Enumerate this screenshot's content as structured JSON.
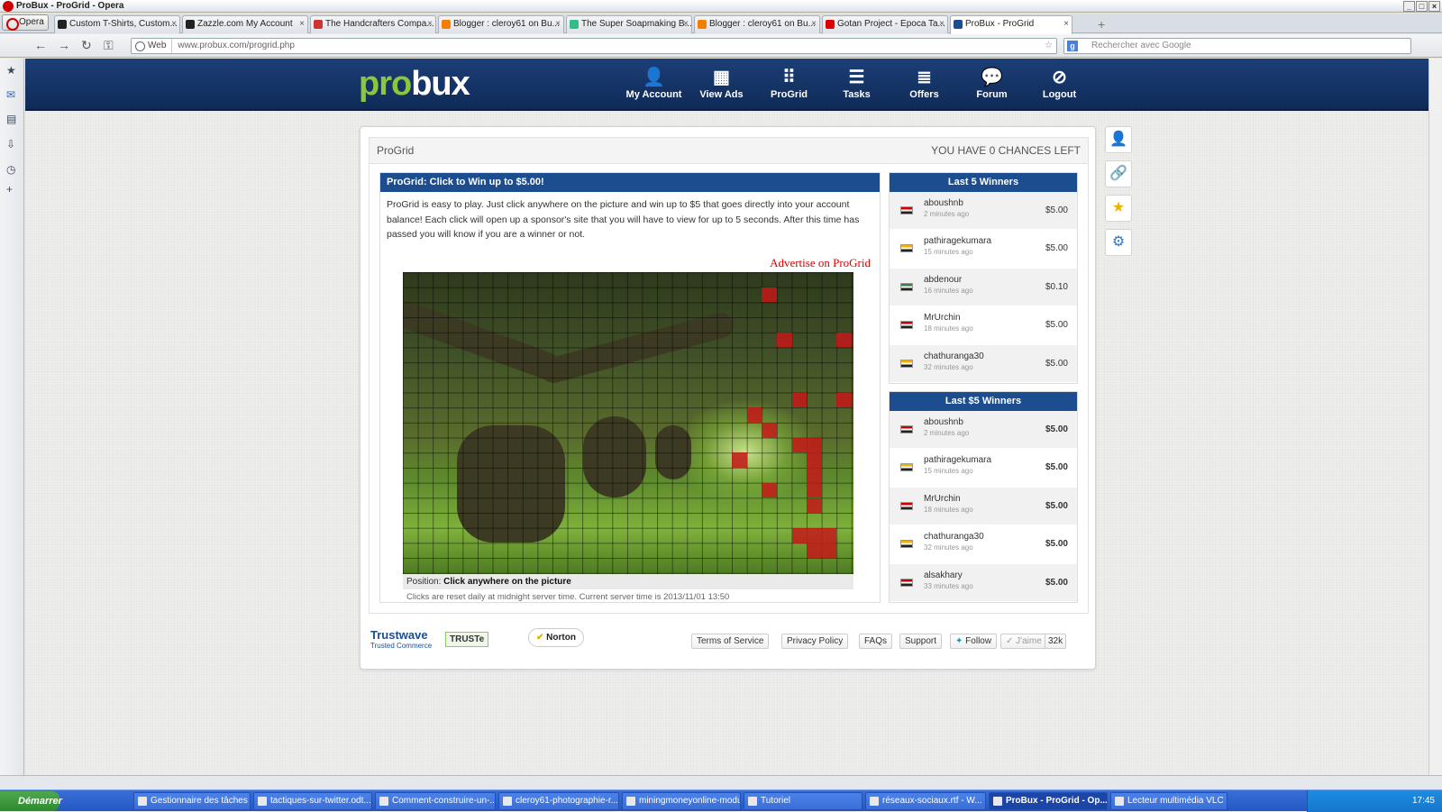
{
  "window": {
    "title": "ProBux - ProGrid - Opera"
  },
  "browser": {
    "menu_label": "Opera",
    "tabs": [
      {
        "label": "Custom T-Shirts, Custom...",
        "color": "#222"
      },
      {
        "label": "Zazzle.com My Account",
        "color": "#222"
      },
      {
        "label": "The Handcrafters Compa...",
        "color": "#c33"
      },
      {
        "label": "Blogger : cleroy61 on Bu...",
        "color": "#f57d00"
      },
      {
        "label": "The Super Soapmaking B...",
        "color": "#3b8"
      },
      {
        "label": "Blogger : cleroy61 on Bu...",
        "color": "#f57d00"
      },
      {
        "label": "Gotan Project - Epoca Ta...",
        "color": "#d00"
      },
      {
        "label": "ProBux - ProGrid",
        "color": "#1b4d8f"
      }
    ],
    "web_label": "Web",
    "url": "www.probux.com/progrid.php",
    "search_placeholder": "Rechercher avec Google"
  },
  "site": {
    "logo_part1": "pro",
    "logo_part2": "bux",
    "nav": [
      {
        "label": "My Account",
        "icon": "user-icon"
      },
      {
        "label": "View Ads",
        "icon": "ads-icon"
      },
      {
        "label": "ProGrid",
        "icon": "grid-icon"
      },
      {
        "label": "Tasks",
        "icon": "tasks-icon"
      },
      {
        "label": "Offers",
        "icon": "offers-icon"
      },
      {
        "label": "Forum",
        "icon": "forum-icon"
      },
      {
        "label": "Logout",
        "icon": "logout-icon"
      }
    ]
  },
  "progrid": {
    "header_title": "ProGrid",
    "chances": "YOU HAVE 0 CHANCES LEFT",
    "panel_title": "ProGrid: Click to Win up to $5.00!",
    "intro": "ProGrid is easy to play. Just click anywhere on the picture and win up to $5 that goes directly into your account balance! Each click will open up a sponsor's site that you will have to view for up to 5 seconds. After this time has passed you will know if you are a winner or not.",
    "advertise": "Advertise on ProGrid",
    "position_label": "Position:",
    "position_value": "Click anywhere on the picture",
    "reset_note": "Clicks are reset daily at midnight server time. Current server time is 2013/11/01 13:50"
  },
  "last5": {
    "title": "Last 5 Winners",
    "rows": [
      {
        "name": "aboushnb",
        "time": "2 minutes ago",
        "amount": "$5.00",
        "flag": "#c00"
      },
      {
        "name": "pathiragekumara",
        "time": "15 minutes ago",
        "amount": "$5.00",
        "flag": "#f5b000"
      },
      {
        "name": "abdenour",
        "time": "16 minutes ago",
        "amount": "$0.10",
        "flag": "#2a8a3a"
      },
      {
        "name": "MrUrchin",
        "time": "18 minutes ago",
        "amount": "$5.00",
        "flag": "#c00"
      },
      {
        "name": "chathuranga30",
        "time": "32 minutes ago",
        "amount": "$5.00",
        "flag": "#f5b000"
      }
    ]
  },
  "last5dollar": {
    "title": "Last $5 Winners",
    "rows": [
      {
        "name": "aboushnb",
        "time": "2 minutes ago",
        "amount": "$5.00",
        "flag": "#c00"
      },
      {
        "name": "pathiragekumara",
        "time": "15 minutes ago",
        "amount": "$5.00",
        "flag": "#f5b000"
      },
      {
        "name": "MrUrchin",
        "time": "18 minutes ago",
        "amount": "$5.00",
        "flag": "#c00"
      },
      {
        "name": "chathuranga30",
        "time": "32 minutes ago",
        "amount": "$5.00",
        "flag": "#f5b000"
      },
      {
        "name": "alsakhary",
        "time": "33 minutes ago",
        "amount": "$5.00",
        "flag": "#c00"
      }
    ]
  },
  "footer": {
    "trustwave": "Trustwave",
    "trustwave_sub": "Trusted Commerce",
    "truste": "TRUSTe",
    "norton": "Norton",
    "links": [
      "Terms of Service",
      "Privacy Policy",
      "FAQs",
      "Support"
    ],
    "follow": "Follow",
    "like": "J'aime",
    "like_count": "32k"
  },
  "taskbar": {
    "start": "Démarrer",
    "items": [
      "Gestionnaire des tâches ...",
      "tactiques-sur-twitter.odt...",
      "Comment-construire-un-...",
      "cleroy61-photographie-r...",
      "miningmoneyonline-modu...",
      "Tutoriel",
      "réseaux-sociaux.rtf - W...",
      "ProBux - ProGrid - Op...",
      "Lecteur multimédia VLC"
    ],
    "clock": "17:45"
  }
}
